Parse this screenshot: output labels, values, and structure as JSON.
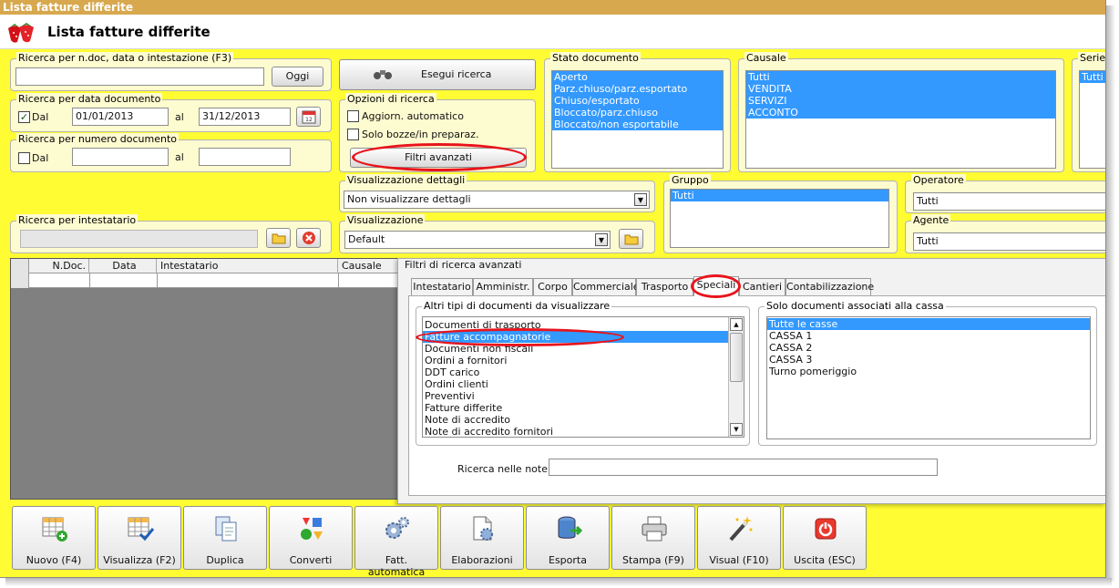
{
  "window": {
    "title": "Lista fatture differite",
    "header": "Lista fatture differite"
  },
  "search_text": {
    "legend": "Ricerca per n.doc, data o intestazione (F3)",
    "value": "",
    "today_button": "Oggi"
  },
  "date_search": {
    "legend": "Ricerca per data documento",
    "from_label": "Dal",
    "from_checked": true,
    "from": "01/01/2013",
    "to_label": "al",
    "to": "31/12/2013"
  },
  "number_search": {
    "legend": "Ricerca per numero documento",
    "from_label": "Dal",
    "from_checked": false,
    "from": "",
    "to_label": "al",
    "to": ""
  },
  "holder_search": {
    "legend": "Ricerca per intestatario",
    "value": ""
  },
  "execute_button": "Esegui ricerca",
  "options": {
    "legend": "Opzioni di ricerca",
    "auto_update": "Aggiorn. automatico",
    "drafts_only": "Solo bozze/in preparaz.",
    "advanced_filters": "Filtri avanzati"
  },
  "doc_status": {
    "legend": "Stato documento",
    "items": [
      "Aperto",
      "Parz.chiuso/parz.esportato",
      "Chiuso/esportato",
      "Bloccato/parz.chiuso",
      "Bloccato/non esportabile"
    ]
  },
  "reason": {
    "legend": "Causale",
    "items": [
      "Tutti",
      "VENDITA",
      "SERVIZI",
      "ACCONTO"
    ]
  },
  "series": {
    "legend": "Serie",
    "items": [
      "Tutti"
    ]
  },
  "details_view": {
    "legend": "Visualizzazione dettagli",
    "value": "Non visualizzare dettagli"
  },
  "view": {
    "legend": "Visualizzazione",
    "value": "Default"
  },
  "group": {
    "legend": "Gruppo",
    "items": [
      "Tutti"
    ]
  },
  "operator": {
    "legend": "Operatore",
    "value": "Tutti"
  },
  "agent": {
    "legend": "Agente",
    "value": "Tutti"
  },
  "table": {
    "columns": [
      "N.Doc.",
      "Data",
      "Intestatario",
      "Causale"
    ]
  },
  "advanced": {
    "legend": "Filtri di ricerca avanzati",
    "tabs": [
      "Intestatario",
      "Amministr.",
      "Corpo",
      "Commerciale",
      "Trasporto",
      "Speciali",
      "Cantieri",
      "Contabilizzazione"
    ],
    "active_tab": "Speciali",
    "doc_types": {
      "legend": "Altri tipi di documenti da visualizzare",
      "items": [
        "Documenti di trasporto",
        "Fatture accompagnatorie",
        "Documenti non fiscali",
        "Ordini a fornitori",
        "DDT carico",
        "Ordini clienti",
        "Preventivi",
        "Fatture differite",
        "Note di accredito",
        "Note di accredito fornitori"
      ],
      "selected": "Fatture accompagnatorie"
    },
    "cash": {
      "legend": "Solo documenti associati alla cassa",
      "items": [
        "Tutte le casse",
        "CASSA 1",
        "CASSA 2",
        "CASSA 3",
        "Turno pomeriggio"
      ],
      "selected": "Tutte le casse"
    },
    "notes_label": "Ricerca nelle note",
    "notes_value": ""
  },
  "toolbar": [
    "Nuovo (F4)",
    "Visualizza (F2)",
    "Duplica",
    "Converti",
    "Fatt. automatica",
    "Elaborazioni",
    "Esporta",
    "Stampa (F9)",
    "Visual (F10)",
    "Uscita (ESC)"
  ]
}
